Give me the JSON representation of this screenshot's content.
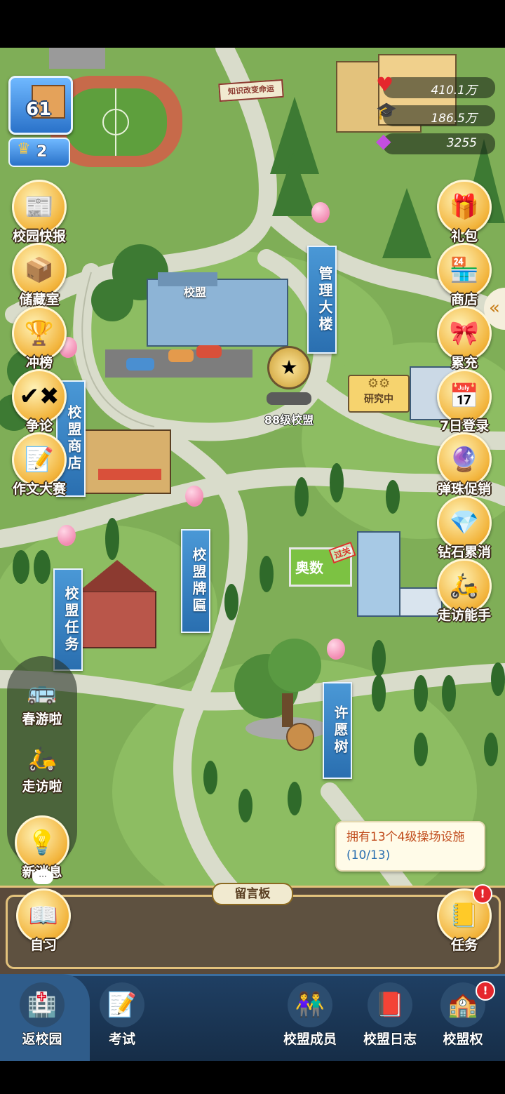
{
  "hud": {
    "school_level": "61",
    "alliance_rank": "2",
    "resources": [
      {
        "icon": "heart-icon",
        "value": "410.1万"
      },
      {
        "icon": "graduation-cap-icon",
        "value": "186.5万"
      },
      {
        "icon": "diamond-icon",
        "value": "3255"
      }
    ]
  },
  "map": {
    "billboard": "知识改变命运",
    "buildings": {
      "admin_building": "管理大楼",
      "alliance_hall_sign": "校盟",
      "alliance_badge": "88级校盟",
      "research": "研究中",
      "olympiad_sign": "奥数",
      "olympiad_stamp": "过关",
      "alliance_shop": "校盟商店",
      "alliance_plaque": "校盟牌匾",
      "alliance_task": "校盟任务",
      "wish_tree": "许愿树"
    }
  },
  "left_menu": [
    {
      "name": "school-news",
      "label": "校园快报",
      "icon": "newspaper-icon"
    },
    {
      "name": "storage-room",
      "label": "储藏室",
      "icon": "boxes-icon"
    },
    {
      "name": "ranking",
      "label": "冲榜",
      "icon": "trophy-icon"
    },
    {
      "name": "debate",
      "label": "争论",
      "icon": "debate-icon"
    },
    {
      "name": "essay-contest",
      "label": "作文大赛",
      "icon": "essay-icon"
    }
  ],
  "right_menu": [
    {
      "name": "gift-pack",
      "label": "礼包",
      "icon": "gift-icon"
    },
    {
      "name": "store",
      "label": "商店",
      "icon": "store-icon"
    },
    {
      "name": "recharge",
      "label": "累充",
      "icon": "gift-box-icon"
    },
    {
      "name": "seven-day-login",
      "label": "7日登录",
      "icon": "calendar-icon"
    },
    {
      "name": "marble-sale",
      "label": "弹珠促销",
      "icon": "marble-shop-icon"
    },
    {
      "name": "diamond-sale",
      "label": "钻石累消",
      "icon": "gem-icon"
    },
    {
      "name": "visit-expert",
      "label": "走访能手",
      "icon": "scooter-rider-icon"
    }
  ],
  "side_panel": [
    {
      "name": "spring-trip",
      "label": "春游啦",
      "icon": "bus-icon"
    },
    {
      "name": "visit",
      "label": "走访啦",
      "icon": "scooter-icon"
    },
    {
      "name": "new-message",
      "label": "新消息",
      "icon": "lightbulb-icon"
    }
  ],
  "message_board": {
    "title": "留言板",
    "self_study": "自习",
    "task": "任务",
    "tooltip_text": "拥有13个4级操场设施",
    "tooltip_progress": "(10/13)"
  },
  "bottom_nav": [
    {
      "name": "campus",
      "label": "返校园",
      "icon": "hospital-building-icon"
    },
    {
      "name": "exam",
      "label": "考试",
      "icon": "exam-paper-icon"
    },
    {
      "name": "alliance-members",
      "label": "校盟成员",
      "icon": "members-icon"
    },
    {
      "name": "alliance-book",
      "label": "校盟日志",
      "icon": "book-icon"
    },
    {
      "name": "alliance-rights",
      "label": "校盟权",
      "icon": "alliance-building-icon"
    }
  ],
  "colors": {
    "grass": "#7fae57",
    "path": "#d9dccb",
    "banner_blue": "#2a6fb0",
    "board_brown": "#5a4a3b",
    "nav_bg": "#1f3f63",
    "label_outline": "#3a2a18"
  }
}
